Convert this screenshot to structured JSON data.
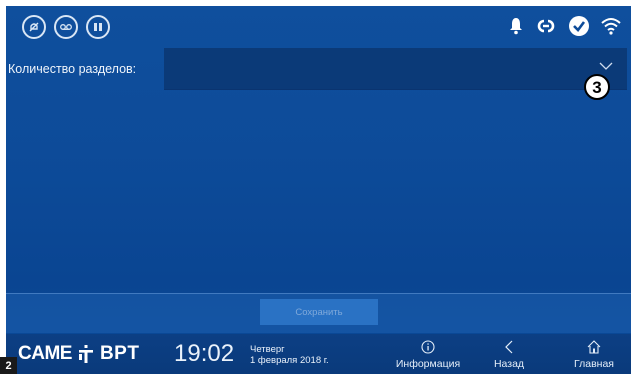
{
  "status_bar": {
    "left_icons": [
      {
        "name": "doorbell-mute-icon",
        "glyph": ""
      },
      {
        "name": "voicemail-icon",
        "glyph": ""
      },
      {
        "name": "lock-icon",
        "glyph": ""
      }
    ],
    "right_icons": [
      "bell-icon",
      "link-icon",
      "check-icon",
      "wifi-icon"
    ]
  },
  "form": {
    "label": "Количество разделов:",
    "value": ""
  },
  "callout": "3",
  "save_label": "Сохранить",
  "bottom_bar": {
    "logo_left": "CAME",
    "logo_right": "BPT",
    "time": "19:02",
    "weekday": "Четверг",
    "date": "1 февраля 2018 г.",
    "nav": {
      "info": "Информация",
      "back": "Назад",
      "home": "Главная"
    }
  },
  "page_badge": "2",
  "colors": {
    "background": "#0d4b99",
    "dropdown": "#0b3a78",
    "save_button": "#2a72c4"
  }
}
